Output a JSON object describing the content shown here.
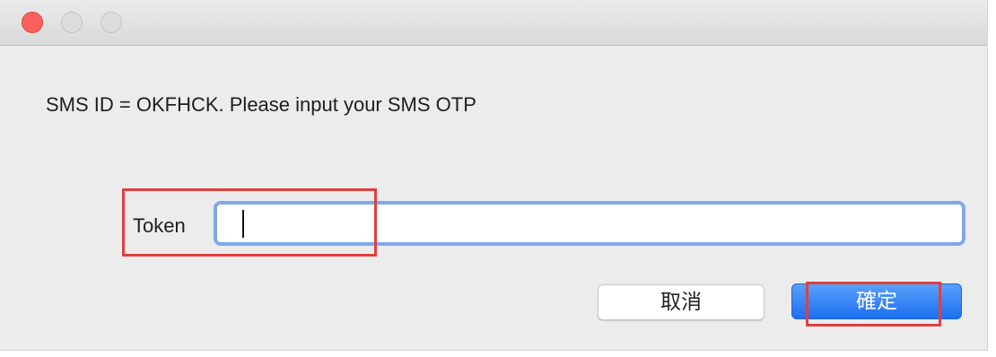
{
  "dialog": {
    "message": "SMS ID = OKFHCK. Please input your SMS OTP",
    "token_label": "Token",
    "token_value": "",
    "cancel_label": "取消",
    "ok_label": "確定"
  },
  "window_controls": [
    "close-icon",
    "minimize-icon",
    "maximize-icon"
  ],
  "colors": {
    "accent": "#1c6ff0",
    "focus_ring": "#7fa8e8",
    "annotation": "#e0403f",
    "close_button": "#fc605c"
  }
}
